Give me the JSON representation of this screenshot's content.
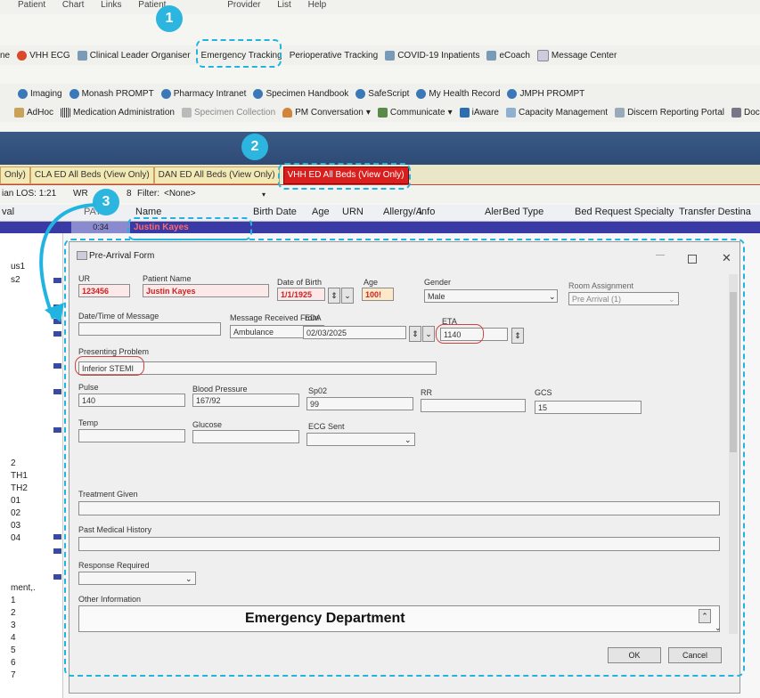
{
  "menubar": {
    "items": [
      "Patient",
      "Chart",
      "Links",
      "Patient",
      "Provider",
      "List",
      "Help"
    ]
  },
  "toolbar1": {
    "items": [
      "ne",
      "VHH ECG",
      "Clinical Leader Organiser",
      "Emergency Tracking",
      "Perioperative Tracking",
      "COVID-19 Inpatients",
      "eCoach",
      "Message Center"
    ]
  },
  "toolbar2": {
    "items": [
      "Imaging",
      "Monash PROMPT",
      "Pharmacy Intranet",
      "Specimen Handbook",
      "SafeScript",
      "My Health Record",
      "JMPH PROMPT"
    ]
  },
  "toolbar3": {
    "items": [
      "AdHoc",
      "Medication Administration",
      "Specimen Collection",
      "PM Conversation",
      "Communicate",
      "iAware",
      "Capacity Management",
      "Discern Reporting Portal",
      "Docu"
    ]
  },
  "tabs": {
    "t1": "Only)",
    "t2": "CLA ED All Beds (View Only)",
    "t3": "DAN ED All Beds (View Only)",
    "t4": "VHH ED All Beds (View Only)"
  },
  "filterbar": {
    "los": "ian LOS: 1:21",
    "wr": "WR",
    "wr_count": "8",
    "filter_label": "Filter:",
    "filter_value": "<None>"
  },
  "grid": {
    "headers": [
      "val",
      "PATI",
      "Name",
      "Birth Date",
      "Age",
      "URN",
      "Allergy/A",
      "Info",
      "Aler",
      "Bed Type",
      "Bed Request Specialty",
      "Transfer Destina"
    ],
    "selected_row": {
      "time": "0:34",
      "name": "Justin Kayes"
    },
    "left_labels": [
      "us1",
      "s2",
      "",
      "",
      "",
      "",
      "",
      "",
      "",
      "",
      "",
      "",
      "",
      "2",
      "TH1",
      "TH2",
      "01",
      "02",
      "03",
      "04",
      "",
      "ment,.",
      "1",
      "2",
      "3",
      "4",
      "5",
      "6",
      "7"
    ]
  },
  "form": {
    "title": "Pre-Arrival Form",
    "ur_label": "UR",
    "ur_value": "123456",
    "patient_name_label": "Patient Name",
    "patient_name_value": "Justin Kayes",
    "dob_label": "Date of Birth",
    "dob_value": "1/1/1925",
    "age_label": "Age",
    "age_value": "100!",
    "gender_label": "Gender",
    "gender_value": "Male",
    "room_label": "Room Assignment",
    "room_value": "Pre Arrival (1)",
    "datetime_label": "Date/Time of Message",
    "received_from_label": "Message Received From",
    "received_from_value": "Ambulance",
    "eda_label": "EDA",
    "eda_value": "02/03/2025",
    "eta_label": "ETA",
    "eta_value": "1140",
    "presenting_label": "Presenting Problem",
    "presenting_value": "Inferior STEMI",
    "pulse_label": "Pulse",
    "pulse_value": "140",
    "bp_label": "Blood Pressure",
    "bp_value": "167/92",
    "spo2_label": "Sp02",
    "spo2_value": "99",
    "rr_label": "RR",
    "gcs_label": "GCS",
    "gcs_value": "15",
    "temp_label": "Temp",
    "glucose_label": "Glucose",
    "ecg_label": "ECG Sent",
    "treatment_label": "Treatment Given",
    "pmh_label": "Past Medical History",
    "response_label": "Response Required",
    "other_label": "Other Information",
    "dept_text": "Emergency Department",
    "ok_label": "OK",
    "cancel_label": "Cancel"
  },
  "badges": {
    "b1": "1",
    "b2": "2",
    "b3": "3"
  },
  "colors": {
    "accent": "#22b4e0",
    "selected_row": "#3a3aa6",
    "active_tab": "#d91e1e",
    "alert_red": "#c22222"
  }
}
